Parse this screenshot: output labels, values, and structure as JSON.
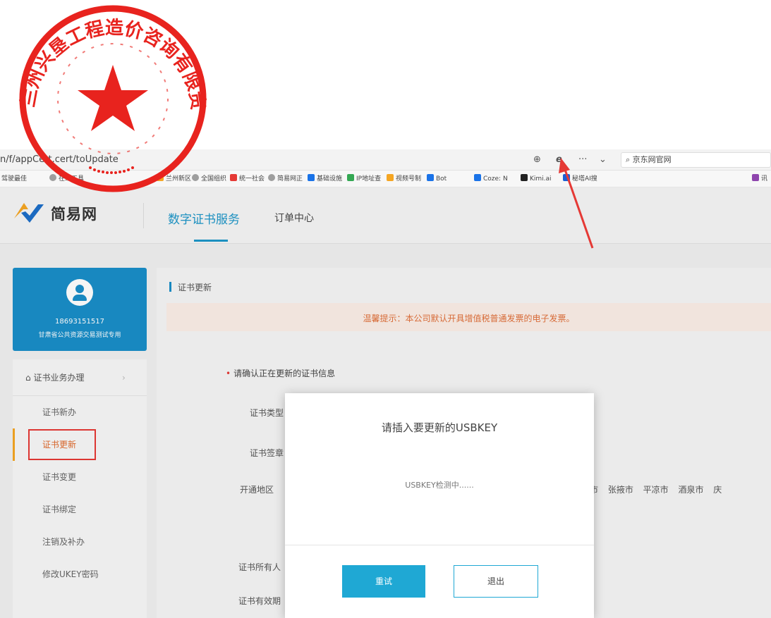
{
  "browser": {
    "url": "n/f/appCert.cert/toUpdate",
    "search_placeholder": "京东网官网",
    "icons": [
      "zoom-icon",
      "ie-mode-icon",
      "more-icon",
      "chevron-down-icon",
      "search-icon"
    ],
    "bookmarks": [
      {
        "label": "驾驶最佳",
        "color": "#888888"
      },
      {
        "label": "在线工具",
        "color": "#9e9e9e"
      },
      {
        "label": "兰州新区",
        "color": "#f5a623"
      },
      {
        "label": "全国组织",
        "color": "#9e9e9e"
      },
      {
        "label": "统一社会",
        "color": "#e53935"
      },
      {
        "label": "简易网正",
        "color": "#9e9e9e"
      },
      {
        "label": "基础设施",
        "color": "#1a73e8"
      },
      {
        "label": "IP地址查",
        "color": "#34a853"
      },
      {
        "label": "视频号制",
        "color": "#f5a623"
      },
      {
        "label": "Bot",
        "color": "#1a73e8"
      },
      {
        "label": "Coze: N",
        "color": "#1a73e8"
      },
      {
        "label": "Kimi.ai",
        "color": "#222222"
      },
      {
        "label": "秘塔AI搜",
        "color": "#1a5fd6"
      },
      {
        "label": "讯",
        "color": "#8e44ad"
      }
    ]
  },
  "header": {
    "brand": "简易网",
    "nav": {
      "cert_service": "数字证书服务",
      "orders": "订单中心"
    },
    "accent": "#1e96c8"
  },
  "user": {
    "phone": "18693151517",
    "org": "甘肃省公共资源交易测试专用"
  },
  "sidebar": {
    "group": "证书业务办理",
    "items": [
      {
        "label": "证书新办",
        "active": false
      },
      {
        "label": "证书更新",
        "active": true
      },
      {
        "label": "证书变更",
        "active": false
      },
      {
        "label": "证书绑定",
        "active": false
      },
      {
        "label": "注销及补办",
        "active": false
      },
      {
        "label": "修改UKEY密码",
        "active": false
      }
    ]
  },
  "content": {
    "title": "证书更新",
    "notice": "温馨提示：本公司默认开具增值税普通发票的电子发票。",
    "confirm": "请确认正在更新的证书信息",
    "labels": {
      "cert_type": "证书类型",
      "cert_seal": "证书签章",
      "region": "开通地区",
      "owner": "证书所有人",
      "validity": "证书有效期"
    },
    "cities": "威市 张掖市 平凉市 酒泉市 庆"
  },
  "modal": {
    "title": "请插入要更新的USBKEY",
    "message": "USBKEY检测中......",
    "retry": "重试",
    "exit": "退出"
  },
  "seal": {
    "text": "兰州兴垦工程造价咨询有限责任公司",
    "color": "#e8231e"
  },
  "annotation_color": "#e53935"
}
